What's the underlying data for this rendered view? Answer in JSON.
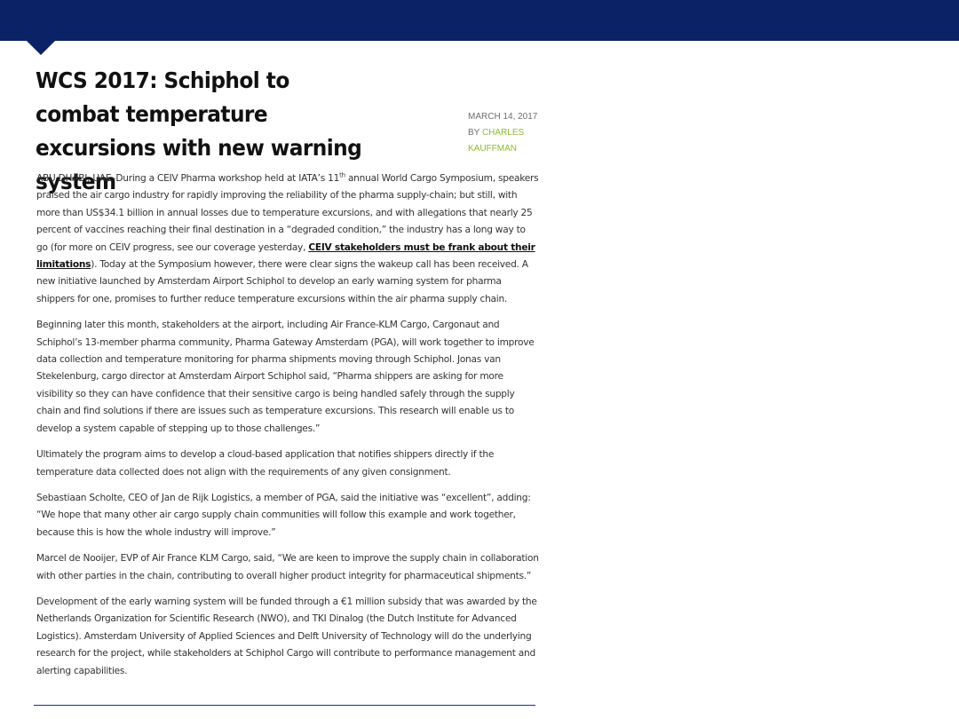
{
  "headline": "WCS 2017: Schiphol to combat temperature excursions with new warning system",
  "byline": {
    "date": "MARCH 14, 2017",
    "by_prefix": "BY ",
    "author": "CHARLES KAUFFMAN"
  },
  "article": {
    "p1_part1": "ABU DHABI, UAE–During a CEIV Pharma workshop held at IATA’s 11",
    "p1_sup": "th",
    "p1_part2": " annual World Cargo Symposium, speakers praised the air cargo industry for rapidly improving the reliability of the pharma supply-chain; but still, with more than US$34.1 billion in annual losses due to temperature excursions, and with allegations that nearly 25 percent of vaccines reaching their final destination in a “degraded condition,” the industry has a long way to go (for more on CEIV progress, see our coverage yesterday, ",
    "p1_link": "CEIV stakeholders must be frank about their limitations",
    "p1_part3": "). Today at the Symposium however, there were clear signs the wakeup call has been received. A new initiative launched by Amsterdam Airport Schiphol to develop an early warning system for pharma shippers for one, promises to further reduce temperature excursions within the air pharma supply chain.",
    "p2": "Beginning later this month, stakeholders at the airport, including Air France-KLM Cargo, Cargonaut and Schiphol’s 13-member pharma community, Pharma Gateway Amsterdam (PGA), will work together to improve data collection and temperature monitoring for pharma shipments moving through Schiphol. Jonas van Stekelenburg, cargo director at Amsterdam Airport Schiphol said, “Pharma shippers are asking for more visibility so they can have confidence that their sensitive cargo is being handled safely through the supply chain and find solutions if there are issues such as temperature excursions. This research will enable us to develop a system capable of stepping up to those challenges.”",
    "p3": "Ultimately the program aims to develop a cloud-based application that notifies shippers directly if the temperature data collected does not align with the requirements of any given consignment.",
    "p4": "Sebastiaan Scholte, CEO of Jan de Rijk Logistics, a member of PGA, said the initiative was “excellent”, adding: “We hope that many other air cargo supply chain communities will follow this example and work together, because this is how the whole industry will improve.”",
    "p5": "Marcel de Nooijer, EVP of Air France KLM Cargo, said, “We are keen to improve the supply chain in collaboration with other parties in the chain, contributing to overall higher product integrity for pharmaceutical shipments.”",
    "p6": "Development of the early warning system will be funded through a €1 million subsidy that was awarded by the Netherlands Organization for Scientific Research (NWO), and TKI Dinalog (the Dutch Institute for Advanced Logistics). Amsterdam University of Applied Sciences and Delft University of Technology will do the underlying research for the project, while stakeholders at Schiphol Cargo will contribute to performance management and alerting capabilities."
  },
  "colors": {
    "header_bar": "#0b2266",
    "author_link": "#8bbb2f",
    "rule": "#1a2f8a"
  }
}
